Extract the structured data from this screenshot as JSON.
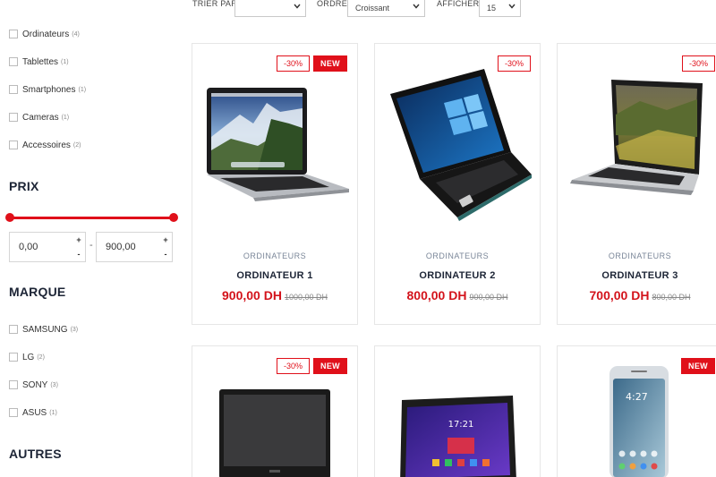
{
  "toolbar": {
    "sort_label": "TRIER PAR",
    "sort_value": "",
    "order_label": "ORDRE",
    "order_value": "Croissant",
    "show_label": "AFFICHER",
    "show_value": "15"
  },
  "categories": [
    {
      "label": "Ordinateurs",
      "count": "(4)"
    },
    {
      "label": "Tablettes",
      "count": "(1)"
    },
    {
      "label": "Smartphones",
      "count": "(1)"
    },
    {
      "label": "Cameras",
      "count": "(1)"
    },
    {
      "label": "Accessoires",
      "count": "(2)"
    }
  ],
  "price_filter": {
    "title": "PRIX",
    "min": "0,00",
    "max": "900,00",
    "separator": "-",
    "range_fraction": [
      0,
      1
    ]
  },
  "brand_filter": {
    "title": "MARQUE",
    "items": [
      {
        "label": "SAMSUNG",
        "count": "(3)"
      },
      {
        "label": "LG",
        "count": "(2)"
      },
      {
        "label": "SONY",
        "count": "(3)"
      },
      {
        "label": "ASUS",
        "count": "(1)"
      }
    ]
  },
  "other_filter": {
    "title": "AUTRES"
  },
  "stepper": {
    "up": "+",
    "down": "-"
  },
  "products": [
    {
      "category": "ORDINATEURS",
      "name": "ORDINATEUR 1",
      "price": "900,00 DH",
      "old_price": "1000,00 DH",
      "discount": "-30%",
      "new": "NEW",
      "image": "macbook-landscape-icon"
    },
    {
      "category": "ORDINATEURS",
      "name": "ORDINATEUR 2",
      "price": "800,00 DH",
      "old_price": "900,00 DH",
      "discount": "-30%",
      "new": "",
      "image": "asus-laptop-windows-icon"
    },
    {
      "category": "ORDINATEURS",
      "name": "ORDINATEUR 3",
      "price": "700,00 DH",
      "old_price": "800,00 DH",
      "discount": "-30%",
      "new": "",
      "image": "macbook-hills-icon"
    },
    {
      "discount": "-30%",
      "new": "NEW",
      "image": "black-laptop-icon"
    },
    {
      "discount": "",
      "new": "",
      "image": "sony-tablet-icon"
    },
    {
      "discount": "",
      "new": "NEW",
      "image": "samsung-phone-icon"
    }
  ],
  "colors": {
    "accent": "#e0101a",
    "price": "#d3131b",
    "title": "#1d2536",
    "category": "#7a8698"
  }
}
